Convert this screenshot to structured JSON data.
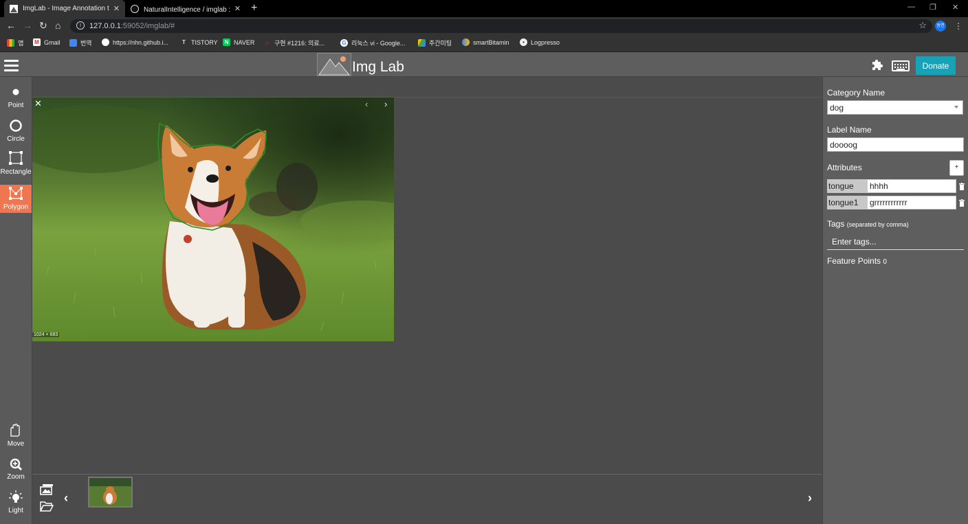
{
  "browser": {
    "tabs": [
      {
        "title": "ImgLab - Image Annotation tool",
        "active": true
      },
      {
        "title": "NaturalIntelligence / imglab : 지",
        "active": false
      }
    ],
    "url_host": "127.0.0.1",
    "url_rest": ":59052/imglab/#",
    "profile_label": "동연",
    "bookmarks": [
      "앱",
      "Gmail",
      "번역",
      "https://nhn.github.i...",
      "TISTORY",
      "NAVER",
      "구현 #1216: 의료...",
      "리눅스 vi - Google...",
      "주간미팅",
      "smartBitamin",
      "Logpresso"
    ]
  },
  "app": {
    "title": "Img Lab",
    "donate_label": "Donate"
  },
  "tools": {
    "point": "Point",
    "circle": "Circle",
    "rectangle": "Rectangle",
    "polygon": "Polygon",
    "move": "Move",
    "zoom": "Zoom",
    "light": "Light",
    "active": "polygon"
  },
  "image": {
    "dimensions_label": "1024 × 683"
  },
  "panel": {
    "category_label": "Category Name",
    "category_value": "dog",
    "label_name_label": "Label Name",
    "label_name_value": "doooog",
    "attributes_label": "Attributes",
    "add_attribute_label": "+",
    "attributes": [
      {
        "key": "tongue",
        "value": "hhhh"
      },
      {
        "key": "tongue1",
        "value": "grrrrrrrrrrrr"
      }
    ],
    "tags_label": "Tags",
    "tags_hint": "(separated by comma)",
    "tags_placeholder": "Enter tags...",
    "feature_points_label": "Feature Points",
    "feature_points_count": "0"
  },
  "colors": {
    "accent_active_tool": "#f0764f",
    "donate_button": "#17a2b8",
    "polygon_outline": "#2e8b2e"
  }
}
